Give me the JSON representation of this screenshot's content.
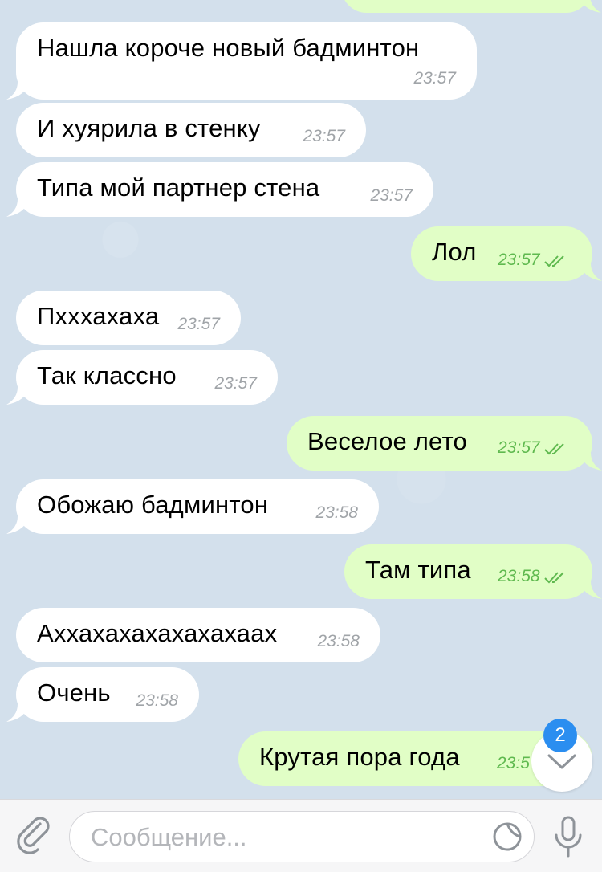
{
  "messages": [
    {
      "text": "",
      "time": "",
      "dir": "out"
    },
    {
      "text": "Нашла короче новый бадминтон",
      "time": "23:57",
      "dir": "in"
    },
    {
      "text": "И хуярила в стенку",
      "time": "23:57",
      "dir": "in"
    },
    {
      "text": "Типа мой партнер стена",
      "time": "23:57",
      "dir": "in"
    },
    {
      "text": "Лол",
      "time": "23:57",
      "dir": "out",
      "read": true
    },
    {
      "text": "Пхххахаха",
      "time": "23:57",
      "dir": "in"
    },
    {
      "text": "Так классно",
      "time": "23:57",
      "dir": "in"
    },
    {
      "text": "Веселое лето",
      "time": "23:57",
      "dir": "out",
      "read": true
    },
    {
      "text": "Обожаю бадминтон",
      "time": "23:58",
      "dir": "in"
    },
    {
      "text": "Там типа",
      "time": "23:58",
      "dir": "out",
      "read": true
    },
    {
      "text": "Аххахахахахахахаах",
      "time": "23:58",
      "dir": "in"
    },
    {
      "text": "Очень",
      "time": "23:58",
      "dir": "in"
    },
    {
      "text": "Крутая пора года",
      "time": "23:5",
      "dir": "out"
    }
  ],
  "scroll_button": {
    "unread_count": "2",
    "icon": "chevron-down-icon"
  },
  "composer": {
    "placeholder": "Сообщение...",
    "attach_icon": "paperclip-icon",
    "sticker_icon": "sticker-icon",
    "mic_icon": "microphone-icon"
  },
  "colors": {
    "background": "#d3e0ec",
    "incoming_bubble": "#ffffff",
    "outgoing_bubble": "#e1fec6",
    "outgoing_time": "#5fb94f",
    "badge": "#2b8ef0"
  }
}
